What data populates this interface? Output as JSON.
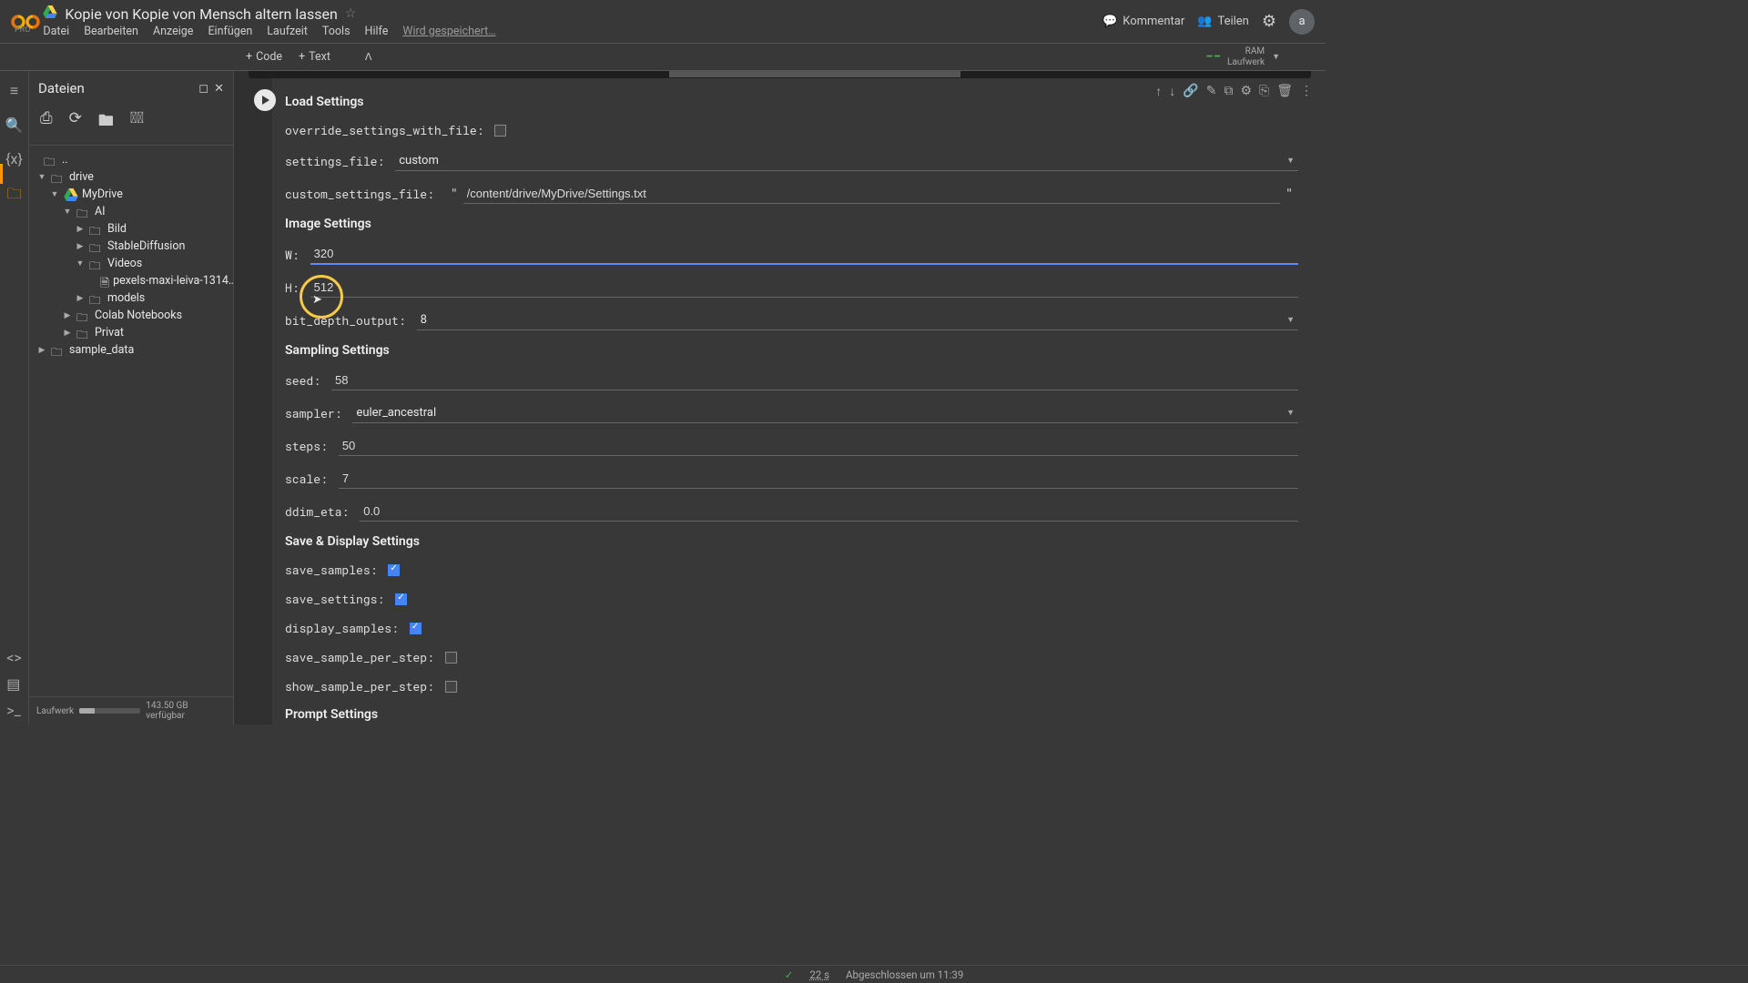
{
  "header": {
    "pro": "PRO",
    "title": "Kopie von Kopie von Mensch altern lassen",
    "menu": [
      "Datei",
      "Bearbeiten",
      "Anzeige",
      "Einfügen",
      "Laufzeit",
      "Tools",
      "Hilfe"
    ],
    "saving": "Wird gespeichert…",
    "comment": "Kommentar",
    "share": "Teilen",
    "avatar": "a"
  },
  "toolbar": {
    "code": "Code",
    "text": "Text",
    "ram": "RAM",
    "disk": "Laufwerk"
  },
  "sidebar": {
    "title": "Dateien",
    "tree": {
      "dotdot": "..",
      "drive": "drive",
      "mydrive": "MyDrive",
      "ai": "AI",
      "bild": "Bild",
      "sd": "StableDiffusion",
      "videos": "Videos",
      "video_file": "pexels-maxi-leiva-1314…",
      "models": "models",
      "colab": "Colab Notebooks",
      "privat": "Privat",
      "sample": "sample_data"
    },
    "footer_label": "Laufwerk",
    "footer_free": "143.50 GB verfügbar"
  },
  "form": {
    "load_h": "Load Settings",
    "override_label": "override_settings_with_file:",
    "settings_file_label": "settings_file:",
    "settings_file_val": "custom",
    "custom_file_label": "custom_settings_file:",
    "custom_file_val": "/content/drive/MyDrive/Settings.txt",
    "image_h": "Image Settings",
    "w_label": "W:",
    "w_val": "320",
    "h_label": "H:",
    "h_val": "512",
    "bit_label": "bit_depth_output:",
    "bit_val": "8",
    "sampling_h": "Sampling Settings",
    "seed_label": "seed:",
    "seed_val": "58",
    "sampler_label": "sampler:",
    "sampler_val": "euler_ancestral",
    "steps_label": "steps:",
    "steps_val": "50",
    "scale_label": "scale:",
    "scale_val": "7",
    "ddim_label": "ddim_eta:",
    "ddim_val": "0.0",
    "save_h": "Save & Display Settings",
    "save_samples_label": "save_samples:",
    "save_settings_label": "save_settings:",
    "display_samples_label": "display_samples:",
    "save_per_step_label": "save_sample_per_step:",
    "show_per_step_label": "show_sample_per_step:",
    "prompt_h": "Prompt Settings"
  },
  "status": {
    "elapsed": "22 s",
    "msg": "Abgeschlossen um 11:39"
  }
}
